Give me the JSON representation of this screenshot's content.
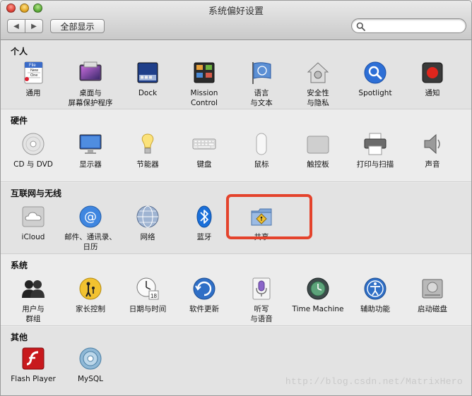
{
  "window": {
    "title": "系统偏好设置",
    "show_all": "全部显示",
    "search_placeholder": "",
    "back_glyph": "◀",
    "forward_glyph": "▶"
  },
  "sections": {
    "personal": {
      "title": "个人",
      "items": [
        "通用",
        "桌面与\n屏幕保护程序",
        "Dock",
        "Mission\nControl",
        "语言\n与文本",
        "安全性\n与隐私",
        "Spotlight",
        "通知"
      ],
      "icon_text": [
        "File",
        "New",
        "One"
      ]
    },
    "hardware": {
      "title": "硬件",
      "items": [
        "CD 与 DVD",
        "显示器",
        "节能器",
        "键盘",
        "鼠标",
        "触控板",
        "打印与扫描",
        "声音"
      ]
    },
    "internet": {
      "title": "互联网与无线",
      "items": [
        "iCloud",
        "邮件、通讯录、\n日历",
        "网络",
        "蓝牙",
        "共享"
      ]
    },
    "system": {
      "title": "系统",
      "items": [
        "用户与\n群组",
        "家长控制",
        "日期与时间",
        "软件更新",
        "听写\n与语音",
        "Time Machine",
        "辅助功能",
        "启动磁盘"
      ],
      "calendar_day": "18"
    },
    "other": {
      "title": "其他",
      "items": [
        "Flash Player",
        "MySQL"
      ]
    }
  },
  "watermark": "http://blog.csdn.net/MatrixHero",
  "colors": {
    "highlight": "#e4432c",
    "spotlight": "#2d6fd6",
    "bluetooth": "#1a6fd9"
  }
}
